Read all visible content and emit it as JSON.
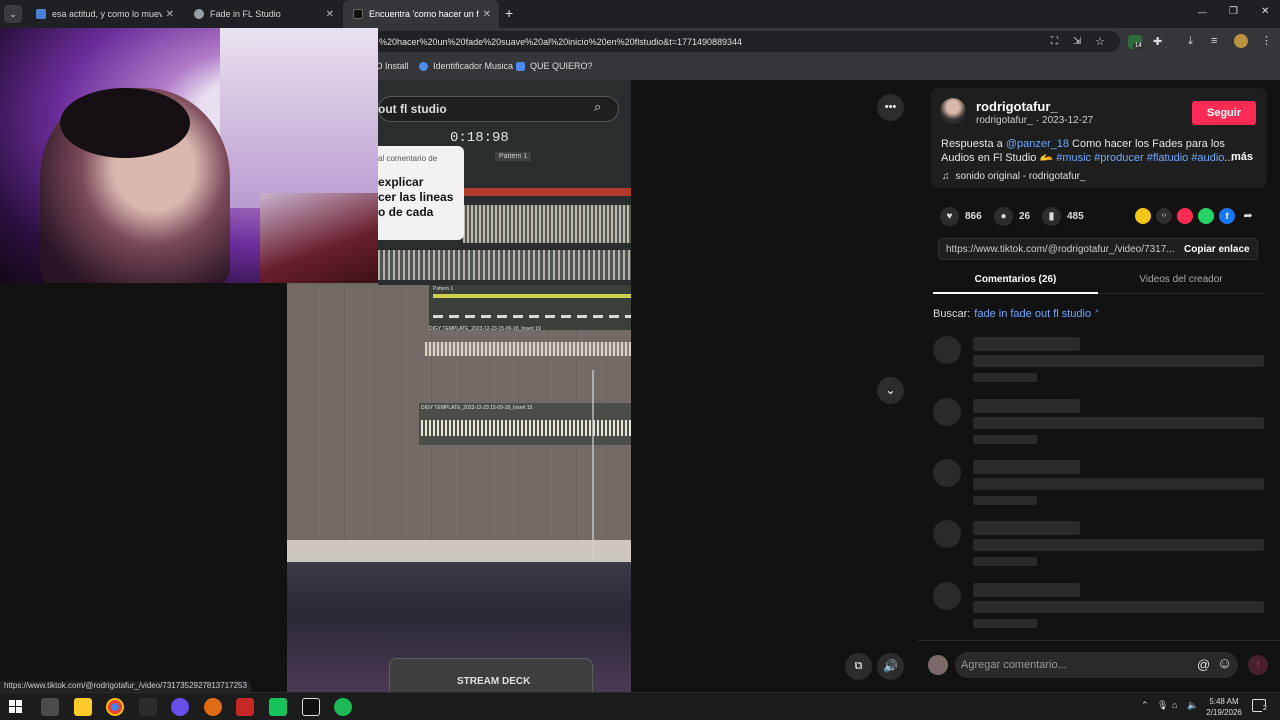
{
  "tabs": [
    {
      "title": "esa actitud, y como lo mueve ·",
      "icon_color": "#4a7fd6"
    },
    {
      "title": "Fade in FL Studio",
      "icon_color": "#9aa0a6"
    },
    {
      "title": "Encuentra 'como hacer un fade",
      "icon_color": "#111111"
    }
  ],
  "new_tab": "+",
  "window_controls": {
    "minimize": "—",
    "restore": "❐",
    "close": "✕"
  },
  "address": {
    "url": "%20hacer%20un%20fade%20suave%20al%20inicio%20en%20flstudio&t=1771490889344"
  },
  "extension_badge": "14",
  "bookmarks": [
    {
      "label": "D Install",
      "icon_color": "#4c8bf5"
    },
    {
      "label": "Identificador Musica",
      "icon_color": "#4c8bf5"
    },
    {
      "label": "QUE QUIERO?",
      "icon_color": "#4c8bf5"
    }
  ],
  "video": {
    "search_text": "out fl studio",
    "time_display": "0:18:98",
    "pattern_label": "Pattern 1",
    "comment_reply_label": "al comentario de",
    "caption_lines": [
      "explicar",
      "cer las lineas",
      "o de cada"
    ],
    "track_labels": [
      "Pattern 1",
      "DIGY TEMPLATE_2023-12-23-15-09-18_Insert 19",
      "DIGY TEMPLATE_2023-12-23 15-09-18_Insert 15"
    ],
    "stream_deck_label": "STREAM DECK"
  },
  "more_options": "•••",
  "creator": {
    "display_name": "rodrigotafur_",
    "handle": "rodrigotafur_",
    "separator": "·",
    "date": "2023-12-27",
    "follow_label": "Seguir"
  },
  "description": {
    "prefix": "Respuesta a",
    "mention": "@panzer_18",
    "text": "Como hacer los Fades para los Audios en Fl Studio 🫴",
    "hashtags": "#music #producer #flatudio #audio",
    "ellipsis": "...",
    "more": "más"
  },
  "sound": {
    "label": "sonido original - rodrigotafur_"
  },
  "stats": {
    "likes": "866",
    "comments": "26",
    "saves": "485"
  },
  "share_colors": [
    "#f5c518",
    "#2f2f2f",
    "#fe2c55",
    "#25d366",
    "#1877f2"
  ],
  "link": {
    "url": "https://www.tiktok.com/@rodrigotafur_/video/7317...",
    "copy_label": "Copiar enlace"
  },
  "panel_tabs": {
    "comments": "Comentarios (26)",
    "creator_videos": "Videos del creador"
  },
  "search": {
    "prefix": "Buscar:",
    "query": "fade in fade out fl studio"
  },
  "comment_input": {
    "placeholder": "Agregar comentario...",
    "at": "@",
    "emoji": "☺",
    "send": "↑"
  },
  "status_url": "https://www.tiktok.com/@rodrigotafur_/video/7317352927813717253",
  "taskbar": {
    "apps": [
      "#4c4c4c",
      "#ffca28",
      "#ea4335",
      "#2b2b2b",
      "#6b4ef0",
      "#e06b12",
      "#c62828",
      "#17c25a",
      "#111111",
      "#1db954"
    ],
    "time": "5:48 AM",
    "date": "2/19/2026",
    "notification_count": "2"
  }
}
